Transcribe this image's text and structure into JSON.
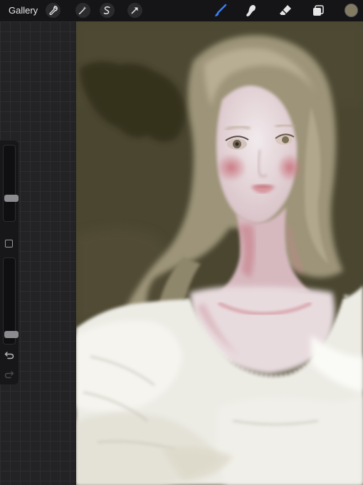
{
  "toolbar": {
    "gallery_label": "Gallery",
    "left_tools": [
      {
        "name": "actions",
        "icon": "wrench-icon"
      },
      {
        "name": "adjustments",
        "icon": "magic-wand-icon"
      },
      {
        "name": "selection",
        "icon": "selection-s-icon"
      },
      {
        "name": "transform",
        "icon": "arrow-cursor-icon"
      }
    ],
    "right_tools": [
      {
        "name": "brush",
        "icon": "brush-icon",
        "active": true
      },
      {
        "name": "smudge",
        "icon": "smudge-finger-icon",
        "active": false
      },
      {
        "name": "eraser",
        "icon": "eraser-icon",
        "active": false
      },
      {
        "name": "layers",
        "icon": "layers-icon",
        "active": false
      }
    ],
    "current_color": "#837a63"
  },
  "colors": {
    "toolbar_bg": "#151517",
    "active_tool": "#3b7ff5",
    "canvas_background": "#4a4630"
  },
  "sidebar": {
    "brush_size_level": 0.28,
    "opacity_level": 0.07,
    "modify_button": "square-icon",
    "undo_icon": "undo-icon",
    "redo_icon": "redo-icon"
  }
}
